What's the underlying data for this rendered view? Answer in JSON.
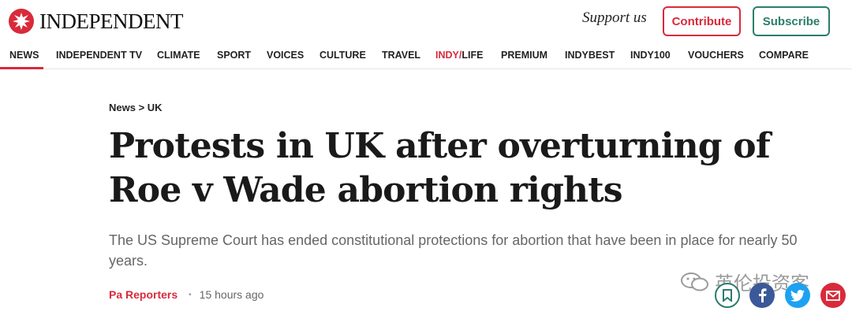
{
  "header": {
    "logo_text": "INDEPENDENT",
    "support_text": "Support us",
    "contribute_label": "Contribute",
    "subscribe_label": "Subscribe"
  },
  "nav": {
    "items": [
      {
        "label": "NEWS"
      },
      {
        "label": "INDEPENDENT TV"
      },
      {
        "label": "CLIMATE"
      },
      {
        "label": "SPORT"
      },
      {
        "label": "VOICES"
      },
      {
        "label": "CULTURE"
      },
      {
        "label": "TRAVEL"
      },
      {
        "label_a": "INDY",
        "label_sep": "/",
        "label_b": "LIFE"
      },
      {
        "label": "PREMIUM"
      },
      {
        "label": "INDYBEST"
      },
      {
        "label": "INDY100"
      },
      {
        "label": "VOUCHERS"
      },
      {
        "label": "COMPARE"
      }
    ],
    "active": "NEWS"
  },
  "article": {
    "breadcrumb": "News > UK",
    "headline_line1": "Protests in UK after overturning of",
    "headline_line2": "Roe v Wade abortion rights",
    "standfirst": "The US Supreme Court has ended constitutional protections for abortion that have been in place for nearly 50 years.",
    "author": "Pa Reporters",
    "separator": "•",
    "time": "15 hours ago"
  },
  "watermark": {
    "text": "英伦投资客"
  },
  "share": {
    "icons": [
      "bookmark-icon",
      "facebook-icon",
      "twitter-icon",
      "email-icon"
    ]
  },
  "colors": {
    "brand_red": "#d92a3b",
    "brand_green": "#2c7d6a",
    "facebook": "#3b5998",
    "twitter": "#1da1f2"
  }
}
